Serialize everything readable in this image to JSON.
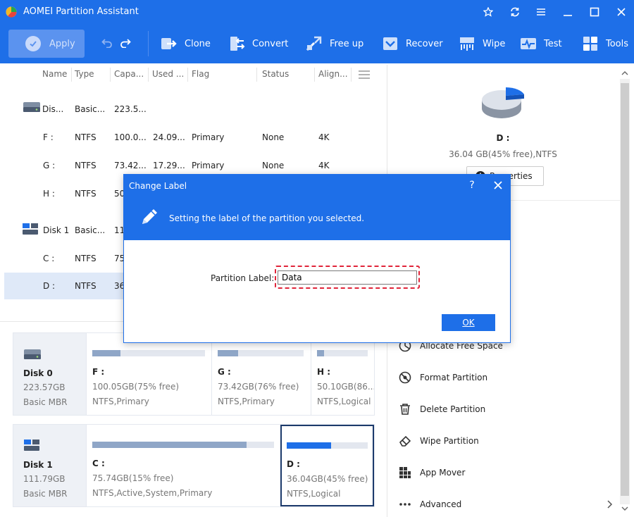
{
  "app": {
    "title": "AOMEI Partition Assistant"
  },
  "toolbar": {
    "apply": "Apply",
    "items": [
      "Clone",
      "Convert",
      "Free up",
      "Recover",
      "Wipe",
      "Test",
      "Tools"
    ]
  },
  "table": {
    "headers": [
      "Name",
      "Type",
      "Capa...",
      "Used ...",
      "Flag",
      "Status",
      "Align..."
    ],
    "rows": [
      {
        "name": "Dis...",
        "type": "Basic...",
        "capacity": "223.5...",
        "used": "",
        "flag": "",
        "status": "",
        "align": ""
      },
      {
        "name": "F :",
        "type": "NTFS",
        "capacity": "100.0...",
        "used": "24.09...",
        "flag": "Primary",
        "status": "None",
        "align": "4K"
      },
      {
        "name": "G :",
        "type": "NTFS",
        "capacity": "73.42...",
        "used": "17.29...",
        "flag": "Primary",
        "status": "None",
        "align": "4K"
      },
      {
        "name": "H :",
        "type": "NTFS",
        "capacity": "50",
        "used": "",
        "flag": "",
        "status": "",
        "align": ""
      },
      {
        "name": "Disk 1",
        "type": "Basic...",
        "capacity": "111",
        "used": "",
        "flag": "",
        "status": "",
        "align": ""
      },
      {
        "name": "C :",
        "type": "NTFS",
        "capacity": "75",
        "used": "",
        "flag": "",
        "status": "",
        "align": ""
      },
      {
        "name": "D :",
        "type": "NTFS",
        "capacity": "36",
        "used": "",
        "flag": "",
        "status": "",
        "align": ""
      }
    ]
  },
  "disks": [
    {
      "name": "Disk 0",
      "size": "223.57GB",
      "type": "Basic MBR",
      "partitions": [
        {
          "name": "F :",
          "free": "100.05GB(75% free)",
          "fs": "NTFS,Primary",
          "used_fraction": 0.25
        },
        {
          "name": "G :",
          "free": "73.42GB(76% free)",
          "fs": "NTFS,Primary",
          "used_fraction": 0.24
        },
        {
          "name": "H :",
          "free": "50.10GB(86...",
          "fs": "NTFS,Logical",
          "used_fraction": 0.14
        }
      ]
    },
    {
      "name": "Disk 1",
      "size": "111.79GB",
      "type": "Basic MBR",
      "partitions": [
        {
          "name": "C :",
          "free": "75.74GB(15% free)",
          "fs": "NTFS,Active,System,Primary",
          "used_fraction": 0.85
        },
        {
          "name": "D :",
          "free": "36.04GB(45% free)",
          "fs": "NTFS,Logical",
          "used_fraction": 0.55
        }
      ]
    }
  ],
  "panel": {
    "selected_name": "D :",
    "selected_info": "36.04 GB(45% free),NTFS",
    "properties": "Properties",
    "operations": [
      "Allocate Free Space",
      "Format Partition",
      "Delete Partition",
      "Wipe Partition",
      "App Mover",
      "Advanced"
    ]
  },
  "dialog": {
    "title": "Change Label",
    "help": "?",
    "description": "Setting the label of the partition you selected.",
    "field_label": "Partition Label:",
    "field_value": "Data",
    "ok": "OK"
  },
  "colors": {
    "accent": "#1e6fe8",
    "bar_used": "#8fa6c7",
    "bar_selected": "#1e6fe8",
    "highlight": "#e0253a"
  }
}
